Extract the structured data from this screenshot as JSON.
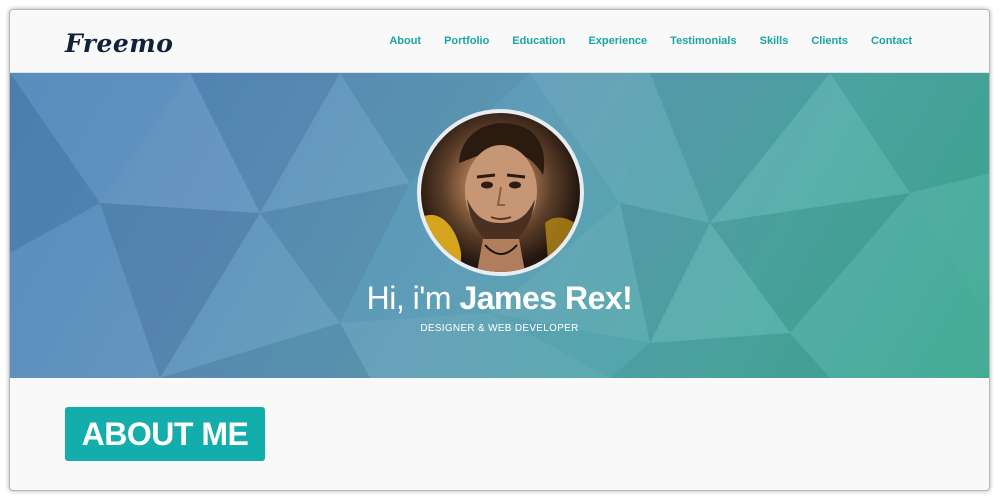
{
  "header": {
    "logo_text": "Freemo",
    "nav": [
      {
        "label": "About"
      },
      {
        "label": "Portfolio"
      },
      {
        "label": "Education"
      },
      {
        "label": "Experience"
      },
      {
        "label": "Testimonials"
      },
      {
        "label": "Skills"
      },
      {
        "label": "Clients"
      },
      {
        "label": "Contact"
      }
    ]
  },
  "hero": {
    "greeting_prefix": "Hi, i'm ",
    "name": "James Rex!",
    "role": "DESIGNER & WEB DEVELOPER"
  },
  "about": {
    "heading": "ABOUT ME"
  },
  "colors": {
    "accent": "#13aeac",
    "nav_link": "#19a5a3",
    "logo": "#10213a",
    "hero_start": "#4e86b9",
    "hero_end": "#3aa88f"
  },
  "icons": {
    "avatar": "profile-photo"
  }
}
